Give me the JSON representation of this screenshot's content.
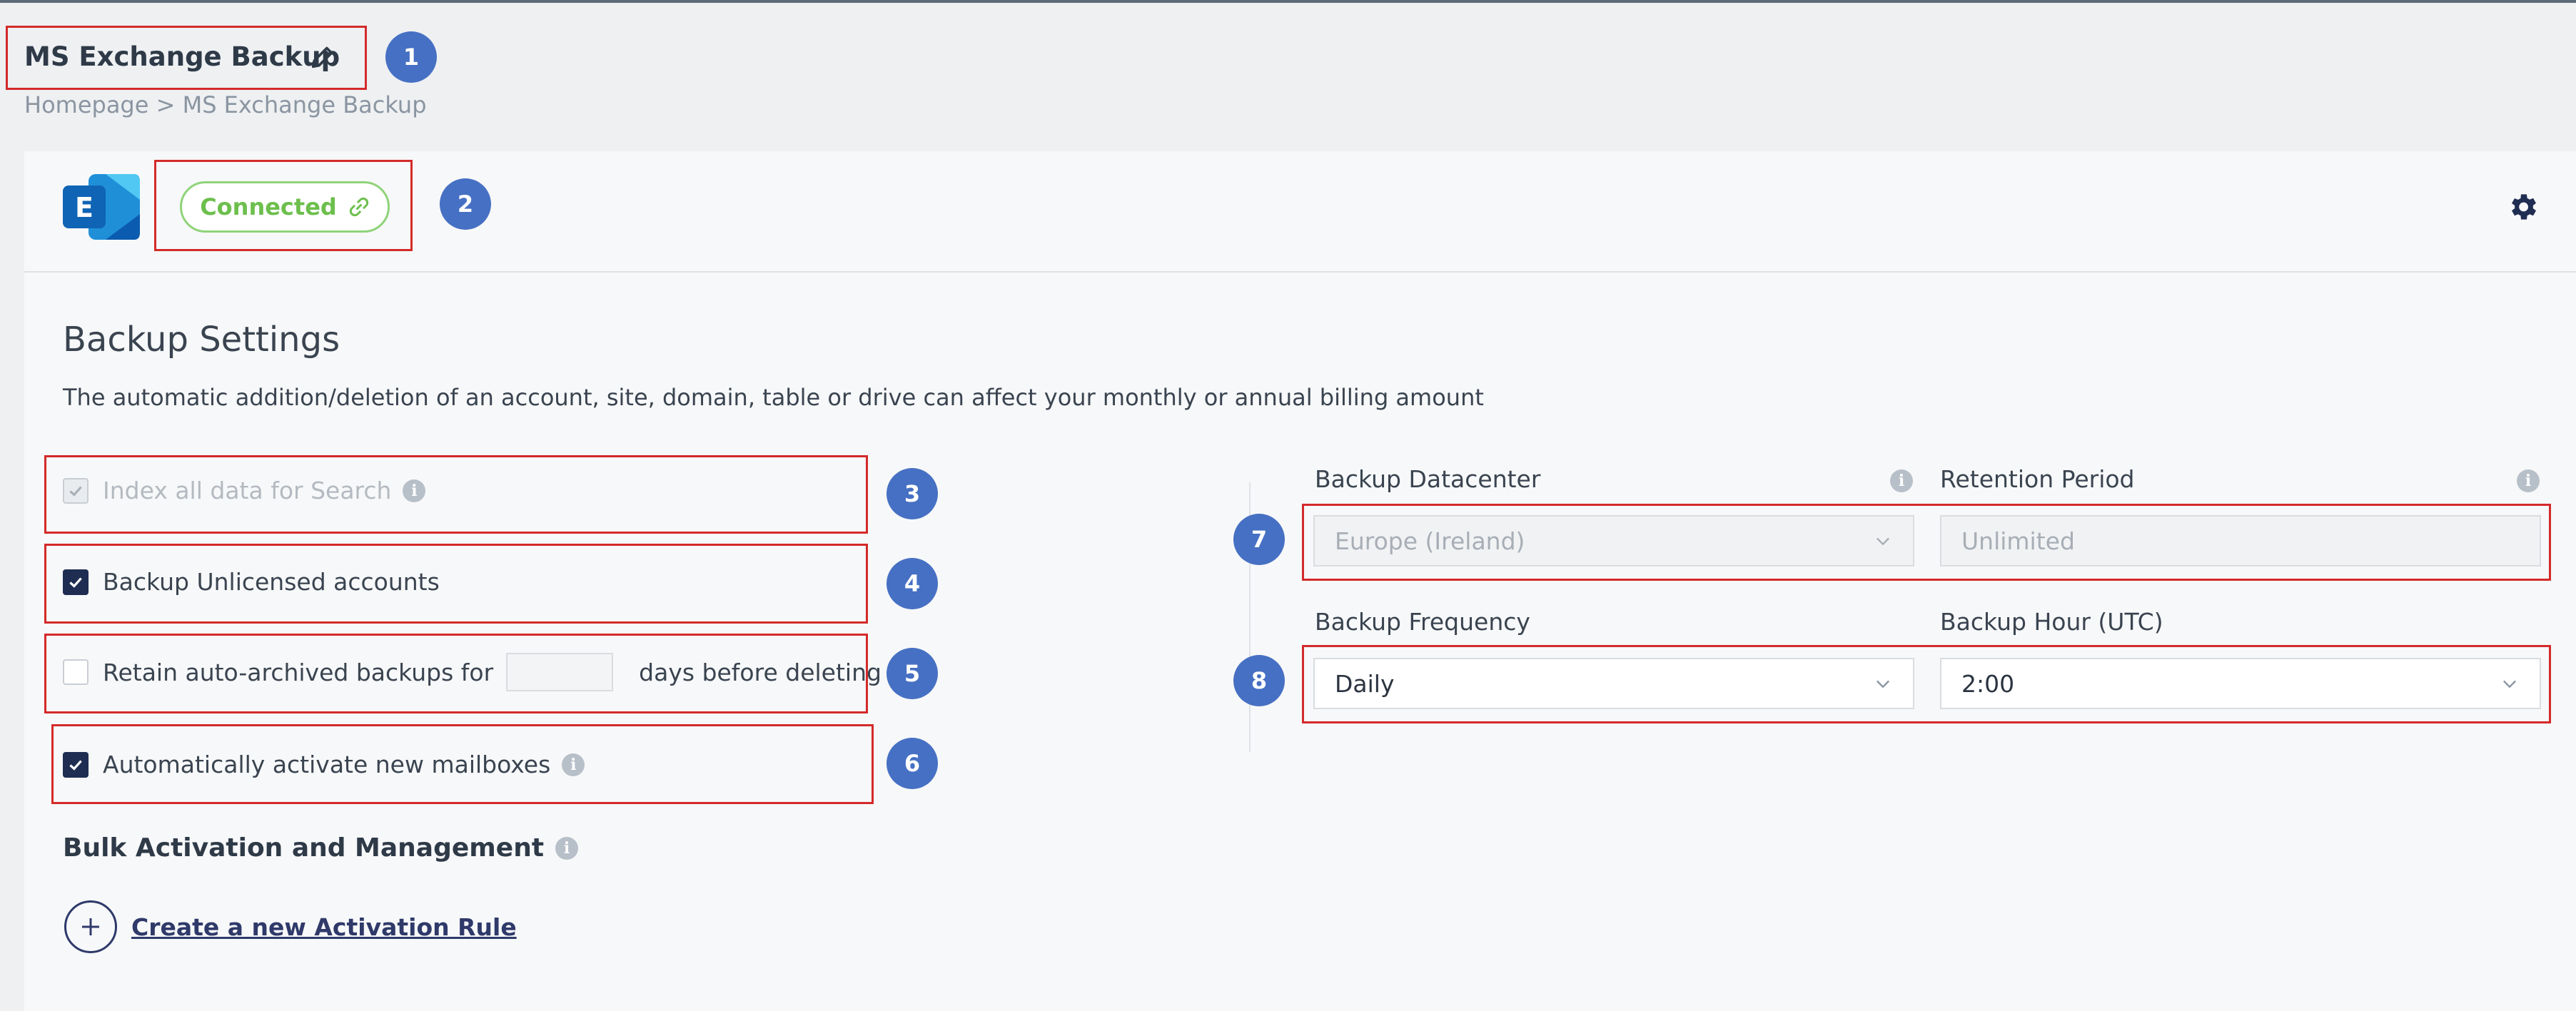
{
  "header": {
    "title": "MS Exchange Backup",
    "breadcrumb": "Homepage > MS Exchange Backup"
  },
  "connection": {
    "status_label": "Connected"
  },
  "backup_settings": {
    "title": "Backup Settings",
    "description": "The automatic addition/deletion of an account, site, domain, table or drive can affect your monthly or annual billing amount",
    "options": {
      "index_search": {
        "label": "Index all data for Search",
        "checked": true,
        "disabled": true
      },
      "unlicensed": {
        "label": "Backup Unlicensed accounts",
        "checked": true
      },
      "retain_prefix": "Retain auto-archived backups for",
      "retain_suffix": "days before deleting",
      "retain_days_value": "",
      "auto_activate": {
        "label": "Automatically activate new mailboxes",
        "checked": true
      }
    }
  },
  "bulk": {
    "title": "Bulk Activation and Management",
    "create_rule_label": "Create a new Activation Rule"
  },
  "fields": {
    "datacenter": {
      "label": "Backup Datacenter",
      "value": "Europe (Ireland)"
    },
    "retention": {
      "label": "Retention Period",
      "placeholder": "Unlimited"
    },
    "frequency": {
      "label": "Backup Frequency",
      "value": "Daily"
    },
    "hour": {
      "label": "Backup Hour (UTC)",
      "value": "2:00"
    }
  },
  "annotations": [
    "1",
    "2",
    "3",
    "4",
    "5",
    "6",
    "7",
    "8"
  ],
  "icons": {
    "edit": "pencil-icon",
    "status": "link-icon",
    "settings": "gear-icon",
    "info": "info-icon",
    "dropdown": "chevron-down-icon",
    "add": "plus-icon"
  },
  "colors": {
    "annotation_box": "#d42a2a",
    "annotation_badge": "#4670c3",
    "connected": "#6cbf4c",
    "checkbox_checked": "#1f2d52"
  }
}
